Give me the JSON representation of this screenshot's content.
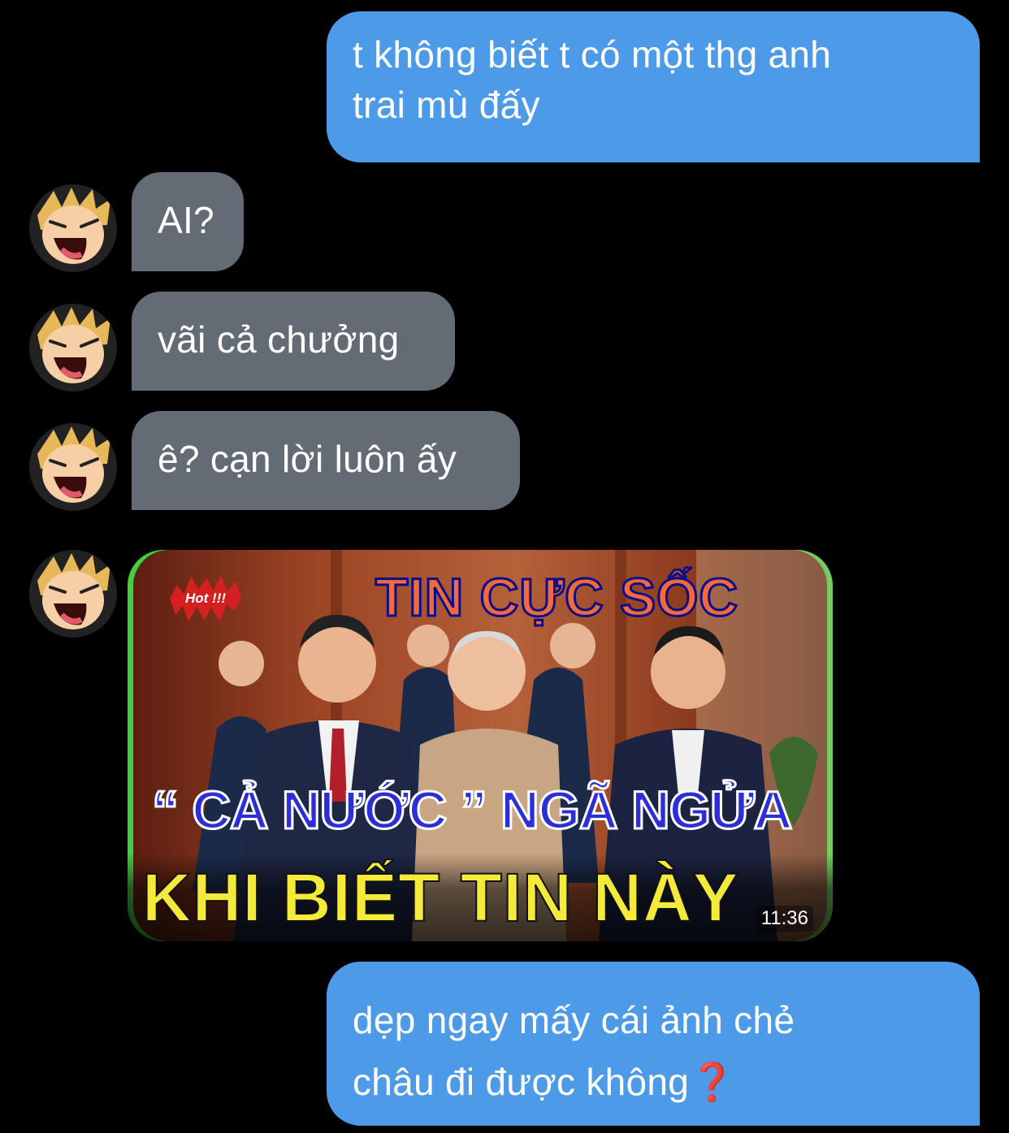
{
  "messages": [
    {
      "id": "m1",
      "direction": "outgoing",
      "line1": "t không biết t có một thg anh",
      "line2": "trai mù đấy"
    },
    {
      "id": "m2",
      "direction": "incoming",
      "text": "AI?"
    },
    {
      "id": "m3",
      "direction": "incoming",
      "text": "vãi cả chưởng"
    },
    {
      "id": "m4",
      "direction": "incoming",
      "text": "ê? cạn lời luôn ấy"
    },
    {
      "id": "m5",
      "direction": "incoming",
      "type": "image",
      "thumbnail": {
        "hot_badge": "Hot !!!",
        "title": "TIN CỰC SỐC",
        "headline": "“ CẢ NƯỚC ” NGÃ NGỬA",
        "subheadline": "KHI BIẾT TIN NÀY",
        "duration": "11:36"
      }
    },
    {
      "id": "m6",
      "direction": "outgoing",
      "line1": "dẹp ngay mấy cái ảnh chẻ",
      "line2": "châu đi được không",
      "trailing_icon": "red-question-mark-icon",
      "trailing_glyph": "❓"
    }
  ],
  "colors": {
    "background": "#000000",
    "outgoing_bubble": "#4d9be8",
    "incoming_bubble": "#636b74",
    "media_border": "#3fd13f"
  },
  "avatar_icon": "laughing-cartoon-avatar-icon"
}
